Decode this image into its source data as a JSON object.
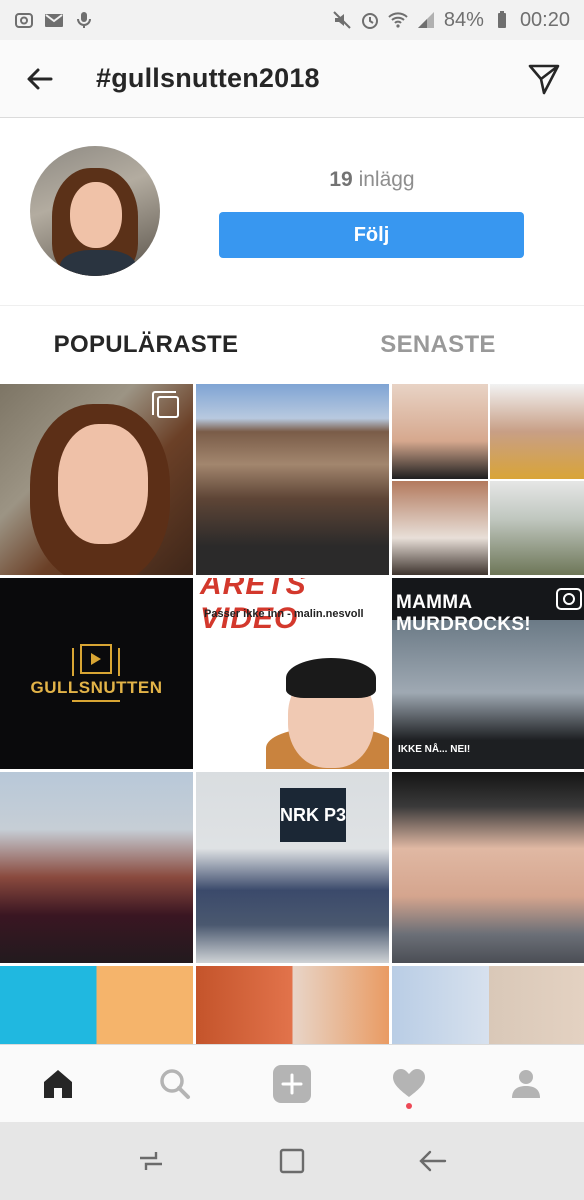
{
  "status_bar": {
    "battery": "84%",
    "time": "00:20",
    "icons": [
      "instagram-notification-icon",
      "gmail-icon",
      "microphone-icon",
      "mute-icon",
      "alarm-icon",
      "wifi-icon",
      "signal-icon",
      "battery-icon"
    ]
  },
  "header": {
    "title": "#gullsnutten2018",
    "back_icon": "back-arrow-icon",
    "send_icon": "direct-message-icon"
  },
  "profile": {
    "posts_count": "19",
    "posts_label": "inlägg",
    "follow_label": "Följ"
  },
  "tabs": [
    {
      "label": "POPULÄRASTE",
      "active": true
    },
    {
      "label": "SENASTE",
      "active": false
    }
  ],
  "grid": {
    "tile5_caption": "ÅRETS VIDEO",
    "tile5_subcaption": "Passer ikke inn - malin.nesvoll",
    "tile4_caption": "GULLSNUTTEN",
    "tile6_caption": "MAMMA MURDROCKS!",
    "tile6_subcaption": "IKKE NÅ... NEI!",
    "tile8_badge": "NRK P3"
  },
  "bottom_nav": {
    "items": [
      "home-icon",
      "search-icon",
      "add-icon",
      "activity-heart-icon",
      "profile-icon"
    ]
  },
  "system_nav": {
    "items": [
      "recent-apps-icon",
      "home-square-icon",
      "back-icon"
    ]
  }
}
